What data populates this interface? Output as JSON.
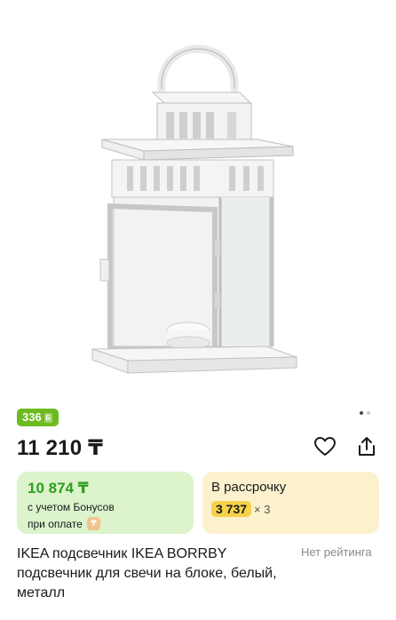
{
  "product": {
    "bonus_badge": "336",
    "price": "11 210 ₸",
    "title": "IKEA подсвечник IKEA BORRBY подсвечник для свечи на блоке, белый, металл",
    "rating_text": "Нет рейтинга"
  },
  "gallery": {
    "images_total": 2,
    "active_index": 0
  },
  "bonus_card": {
    "price": "10 874 ₸",
    "line1": "с учетом Бонусов",
    "line2": "при оплате"
  },
  "installment_card": {
    "title": "В рассрочку",
    "amount": "3 737",
    "times": "× 3"
  },
  "icons": [
    "favorite-heart-icon",
    "share-icon",
    "bonus-coin-icon"
  ],
  "colors": {
    "bonus_green": "#6dbb1e",
    "bonus_card_bg": "#dcf3cc",
    "installment_card_bg": "#fbf1cd",
    "installment_highlight": "#f5d24a"
  }
}
